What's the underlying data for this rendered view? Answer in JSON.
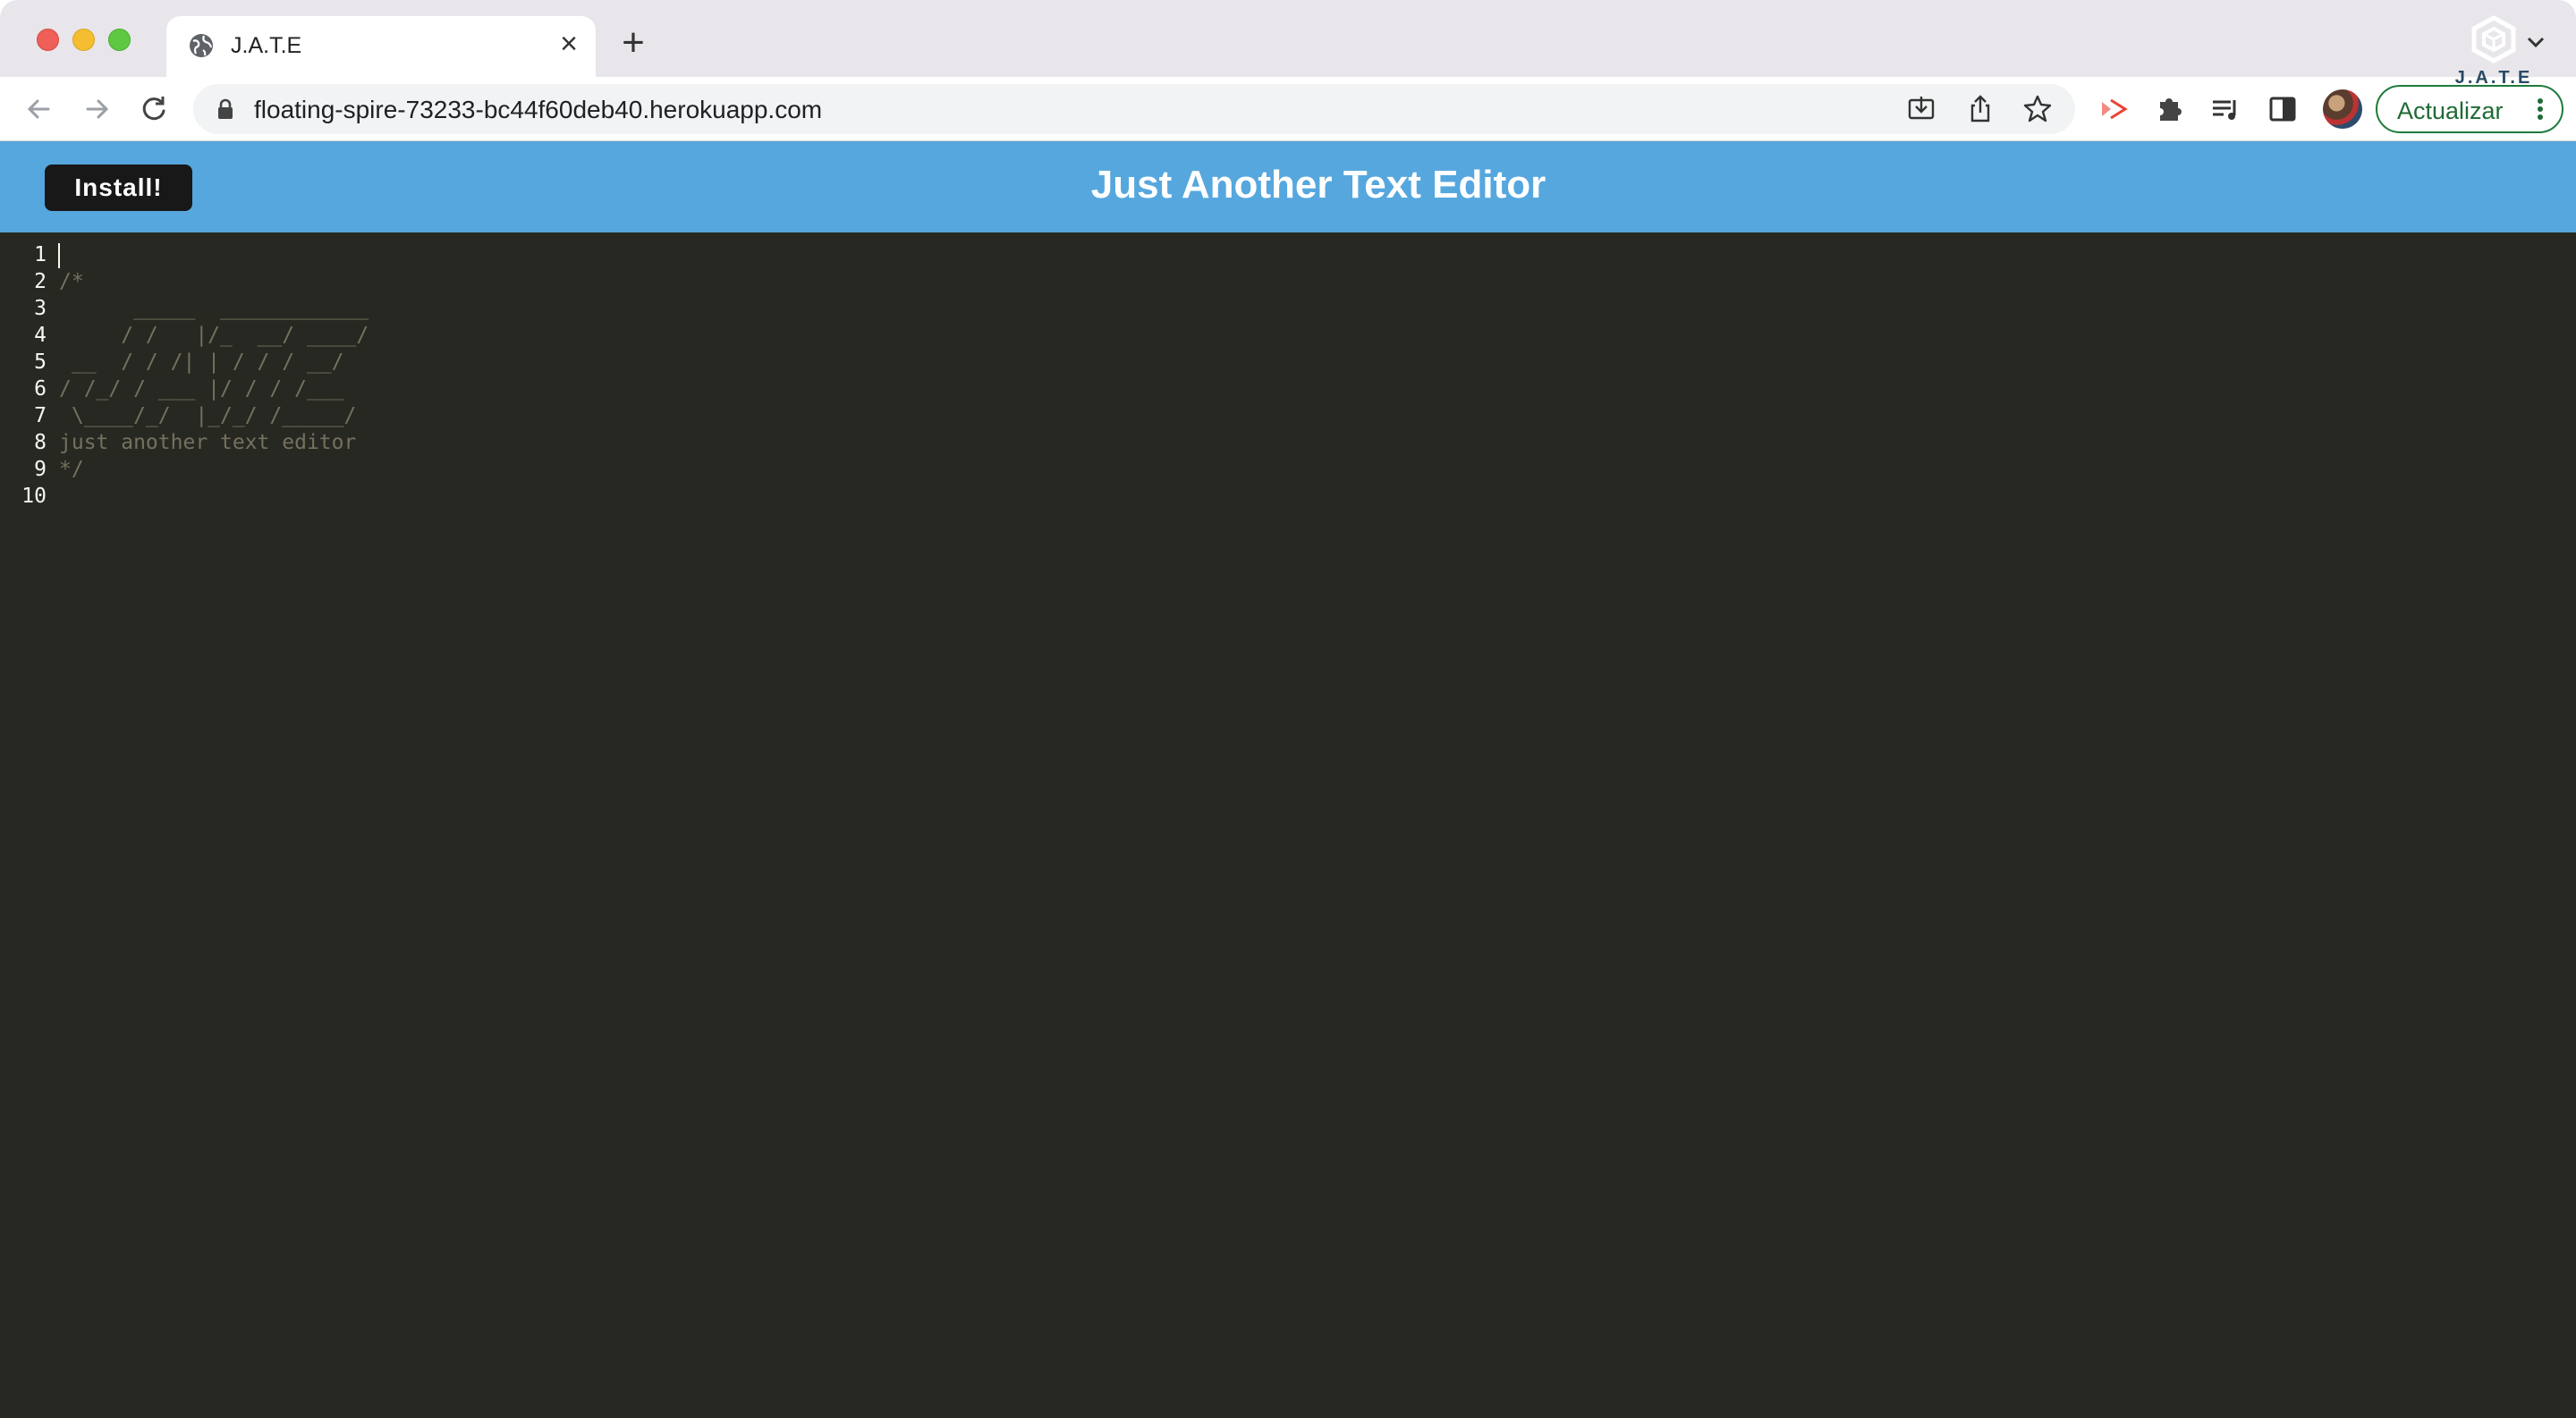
{
  "browser": {
    "tab": {
      "title": "J.A.T.E",
      "icon": "globe-icon"
    },
    "url": "floating-spire-73233-bc44f60deb40.herokuapp.com",
    "update_button_label": "Actualizar",
    "extension_icons": [
      "install-app-icon",
      "share-icon",
      "bookmark-star-icon",
      "cast-icon",
      "extensions-puzzle-icon",
      "media-queue-icon",
      "side-panel-icon"
    ],
    "accent_color": "#1e7b3c"
  },
  "app": {
    "install_label": "Install!",
    "title": "Just Another Text Editor",
    "logo_text": "J.A.T.E",
    "header_color": "#56a7de"
  },
  "editor": {
    "theme": {
      "background": "#272822",
      "comment_color": "#75715e",
      "gutter_color": "#f8f8f2"
    },
    "line_numbers": [
      "1",
      "2",
      "3",
      "4",
      "5",
      "6",
      "7",
      "8",
      "9",
      "10"
    ],
    "lines": [
      "",
      "/*",
      "      _____  ____________",
      "     / /   |/_  __/ ____/",
      " __  / / /| | / / / __/",
      "/ /_/ / ___ |/ / / /___",
      " \\____/_/  |_/_/ /_____/",
      "just another text editor",
      "*/",
      ""
    ]
  }
}
